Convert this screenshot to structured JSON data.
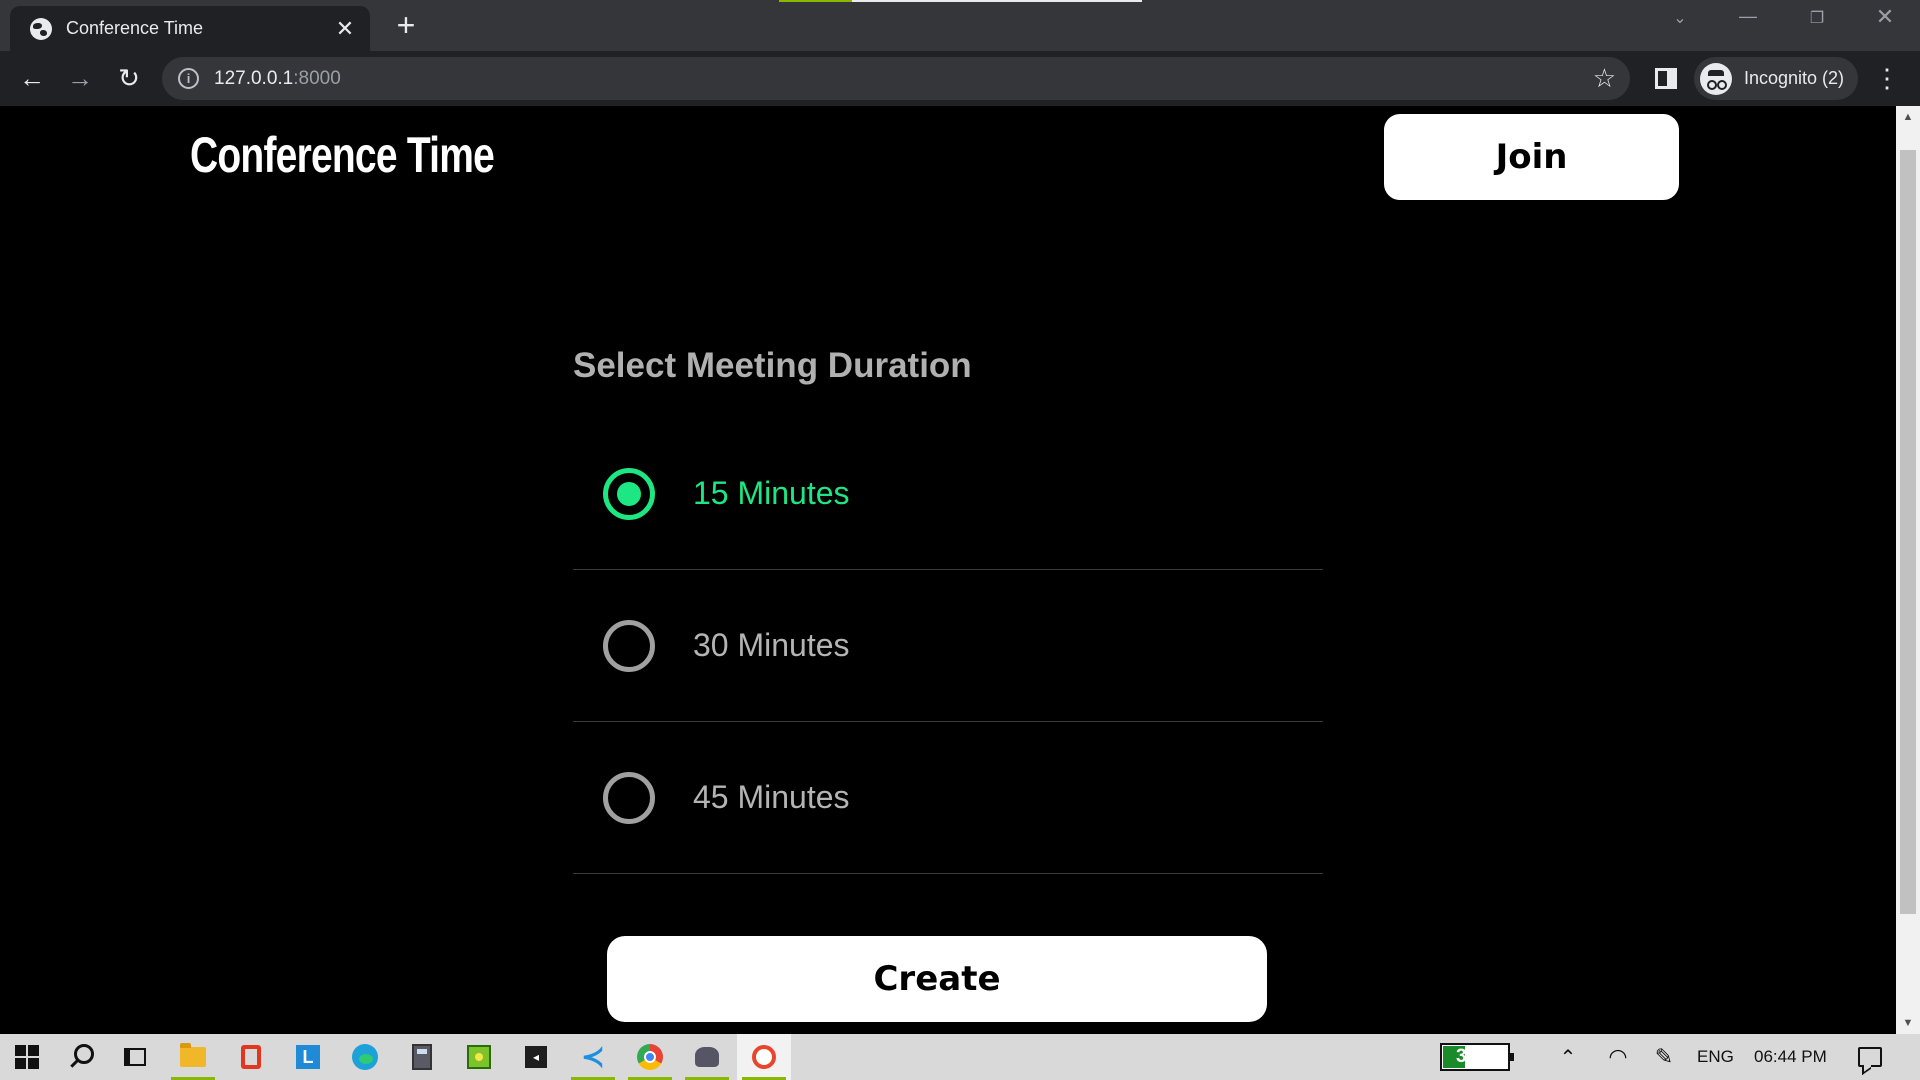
{
  "browser": {
    "tab": {
      "title": "Conference Time",
      "favicon": "globe-icon",
      "close_glyph": "✕"
    },
    "new_tab_glyph": "+",
    "url_host": "127.0.0.1",
    "url_port": ":8000",
    "profile_label": "Incognito (2)",
    "loading_progress": 0.2,
    "icons": {
      "back": "←",
      "forward": "→",
      "reload": "↻",
      "info": "i",
      "bookmark": "☆",
      "menu": "⋮",
      "minimize": "—",
      "maximize": "❐",
      "close": "✕",
      "tab_search": "⌄"
    }
  },
  "page": {
    "app_title": "Conference Time",
    "join_label": "Join",
    "section_title": "Select Meeting Duration",
    "options": [
      {
        "label": "15 Minutes",
        "selected": true
      },
      {
        "label": "30 Minutes",
        "selected": false
      },
      {
        "label": "45 Minutes",
        "selected": false
      }
    ],
    "create_label": "Create",
    "accent_color": "#1de782"
  },
  "taskbar": {
    "apps": [
      "start-windows-icon",
      "search-icon",
      "task-view-icon",
      "file-explorer-icon",
      "office-icon",
      "l-app-icon",
      "edge-icon",
      "calculator-icon",
      "green-app-icon",
      "terminal-icon",
      "vscode-icon",
      "chrome-icon",
      "pidgin-icon",
      "paint-icon"
    ],
    "l_app_letter": "L",
    "battery_percent": "37%",
    "battery_level": 0.37,
    "chevron": "⌃",
    "language": "ENG",
    "time": "06:44 PM"
  }
}
